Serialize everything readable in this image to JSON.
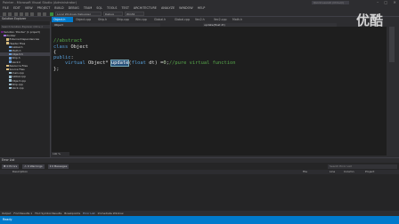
{
  "window": {
    "title": "Pointer - Microsoft Visual Studio (Administrator)",
    "quick_launch": "Quick Launch (Ctrl+Q)",
    "controls": [
      "–",
      "□",
      "✕"
    ]
  },
  "menu": [
    "FILE",
    "EDIT",
    "VIEW",
    "PROJECT",
    "BUILD",
    "DEBUG",
    "TEAM",
    "SQL",
    "TOOLS",
    "TEST",
    "ARCHITECTURE",
    "ANALYZE",
    "WINDOW",
    "HELP"
  ],
  "toolbar": {
    "debugger": "Local Windows Debugger",
    "config": "Debug",
    "platform": "Win32"
  },
  "tabs": [
    "Object.h",
    "Object.cpp",
    "Ship.h",
    "Ship.cpp",
    "Win.cpp",
    "Global.h",
    "Global.cpp",
    "Vec2.h",
    "Vec2.cpp",
    "Math.h"
  ],
  "solution_explorer": {
    "title": "Solution Explorer",
    "search_placeholder": "Search Solution Explorer (Ctrl+;)",
    "items": [
      {
        "label": "Solution 'Pointer' (1 project)",
        "indent": 0
      },
      {
        "label": "Pointer",
        "indent": 1
      },
      {
        "label": "External Dependencies",
        "indent": 2
      },
      {
        "label": "Header Files",
        "indent": 2
      },
      {
        "label": "Global.h",
        "indent": 3
      },
      {
        "label": "Math.h",
        "indent": 3
      },
      {
        "label": "Object.h",
        "indent": 3
      },
      {
        "label": "Ship.h",
        "indent": 3
      },
      {
        "label": "Vec2.h",
        "indent": 3
      },
      {
        "label": "Resource Files",
        "indent": 2
      },
      {
        "label": "Source Files",
        "indent": 2
      },
      {
        "label": "main.cpp",
        "indent": 3
      },
      {
        "label": "Global.cpp",
        "indent": 3
      },
      {
        "label": "Object.cpp",
        "indent": 3
      },
      {
        "label": "Ship.cpp",
        "indent": 3
      },
      {
        "label": "Vec2.cpp",
        "indent": 3
      }
    ],
    "selected_index": 6,
    "bottom_tabs": "Solution Explorer  Class View"
  },
  "editor": {
    "nav_left": "Object",
    "nav_right": "update(float dt)",
    "zoom": "100 %",
    "code": {
      "line1_comment": "//abstract",
      "line2_kw": "class",
      "line2_name": " Object",
      "line3": "{",
      "line4_kw": "public",
      "line4_rest": ":",
      "line5_indent": "    ",
      "line5_kw": "virtual",
      "line5_type": " Object* ",
      "line5_fn": "update",
      "line5_params_a": "(",
      "line5_params_kw": "float",
      "line5_params_b": " dt) =",
      "line5_zero": "0",
      "line5_semicolon": ";",
      "line5_comment": "//pure virtual function",
      "line6": "};"
    }
  },
  "error_list": {
    "title": "Error List",
    "filters": [
      "✖ 0 Errors",
      "⚠ 0 Warnings",
      "ℹ 0 Messages"
    ],
    "search_placeholder": "Search Error List",
    "columns": [
      "Description",
      "File",
      "Line",
      "Column",
      "Project"
    ]
  },
  "output_tabs": [
    "Output",
    "Find Results 1",
    "Find Symbol Results",
    "Breakpoints",
    "Error List",
    "Immediate Window"
  ],
  "output_active_index": 4,
  "status": "Ready",
  "watermark": "优酷"
}
